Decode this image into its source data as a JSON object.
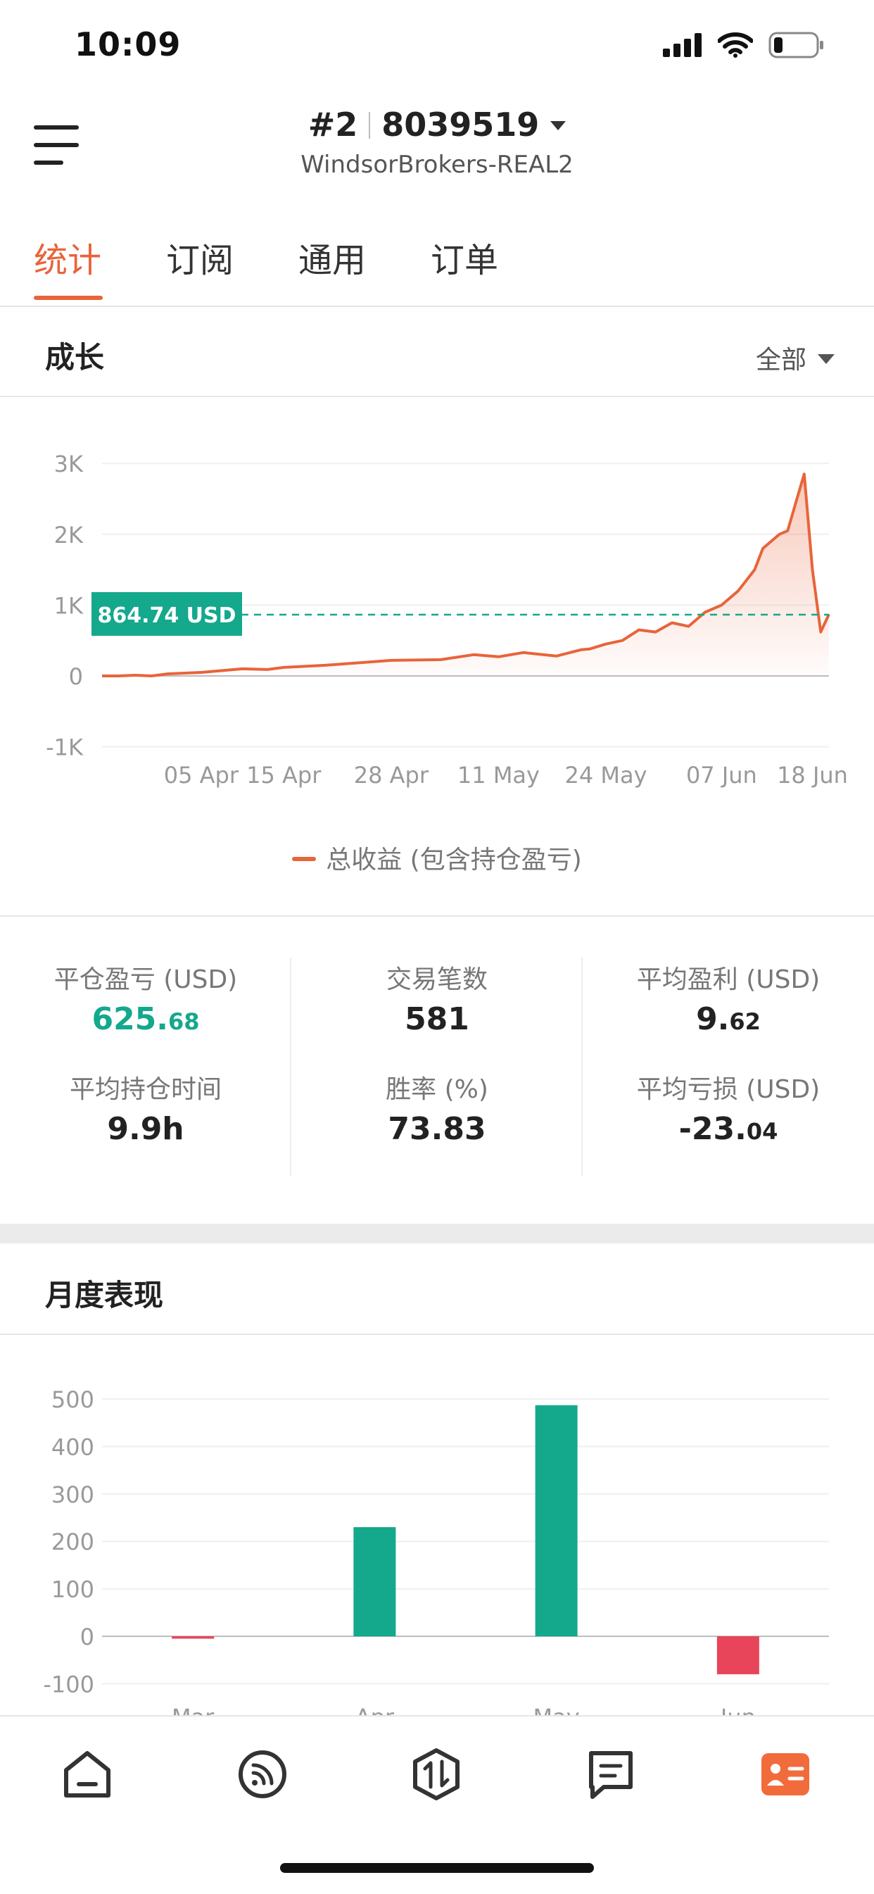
{
  "status_bar": {
    "time": "10:09"
  },
  "header": {
    "account_index": "#2",
    "account_number": "8039519",
    "server": "WindsorBrokers-REAL2"
  },
  "tabs": [
    {
      "label": "统计",
      "active": true
    },
    {
      "label": "订阅",
      "active": false
    },
    {
      "label": "通用",
      "active": false
    },
    {
      "label": "订单",
      "active": false
    }
  ],
  "growth": {
    "title": "成长",
    "range_selector": "全部",
    "current_value_label": "864.74 USD",
    "legend": "总收益 (包含持仓盈亏)"
  },
  "stats": {
    "closed_pnl": {
      "label": "平仓盈亏 (USD)",
      "int": "625.",
      "dec": "68"
    },
    "trades": {
      "label": "交易笔数",
      "value": "581"
    },
    "avg_profit": {
      "label": "平均盈利 (USD)",
      "int": "9.",
      "dec": "62"
    },
    "avg_hold": {
      "label": "平均持仓时间",
      "value": "9.9h"
    },
    "win_rate": {
      "label": "胜率 (%)",
      "value": "73.83"
    },
    "avg_loss": {
      "label": "平均亏损 (USD)",
      "int": "-23.",
      "dec": "04"
    }
  },
  "monthly": {
    "title": "月度表现"
  },
  "colors": {
    "accent": "#e8643a",
    "green": "#14a88c",
    "red": "#e8455a"
  },
  "chart_data": [
    {
      "type": "area",
      "yticks": [
        "3K",
        "2K",
        "1K",
        "0",
        "-1K"
      ],
      "ylim": [
        -1000,
        3000
      ],
      "xticks": [
        "05 Apr",
        "15 Apr",
        "28 Apr",
        "11 May",
        "24 May",
        "07 Jun",
        "18 Jun"
      ],
      "reference_line": 864.74,
      "series": [
        {
          "name": "总收益 (包含持仓盈亏)",
          "x": [
            "24 Mar",
            "26 Mar",
            "28 Mar",
            "30 Mar",
            "01 Apr",
            "05 Apr",
            "10 Apr",
            "13 Apr",
            "15 Apr",
            "20 Apr",
            "28 Apr",
            "04 May",
            "08 May",
            "11 May",
            "14 May",
            "18 May",
            "21 May",
            "22 May",
            "24 May",
            "26 May",
            "28 May",
            "30 May",
            "01 Jun",
            "03 Jun",
            "05 Jun",
            "06 Jun",
            "07 Jun",
            "09 Jun",
            "11 Jun",
            "12 Jun",
            "13 Jun",
            "14 Jun",
            "15 Jun",
            "16 Jun",
            "17 Jun",
            "18 Jun",
            "19 Jun",
            "20 Jun"
          ],
          "values": [
            0,
            0,
            10,
            0,
            30,
            50,
            100,
            90,
            120,
            150,
            220,
            230,
            300,
            270,
            330,
            280,
            370,
            380,
            450,
            500,
            650,
            620,
            750,
            700,
            900,
            950,
            1000,
            1200,
            1500,
            1800,
            1900,
            2000,
            2050,
            2450,
            2850,
            1500,
            620,
            870
          ]
        }
      ]
    },
    {
      "type": "bar",
      "categories": [
        "Mar",
        "Apr",
        "May",
        "Jun"
      ],
      "values": [
        -5,
        230,
        487,
        -80
      ],
      "ylim": [
        -100,
        500
      ],
      "yticks": [
        "500",
        "400",
        "300",
        "200",
        "100",
        "0",
        "-100"
      ]
    }
  ]
}
